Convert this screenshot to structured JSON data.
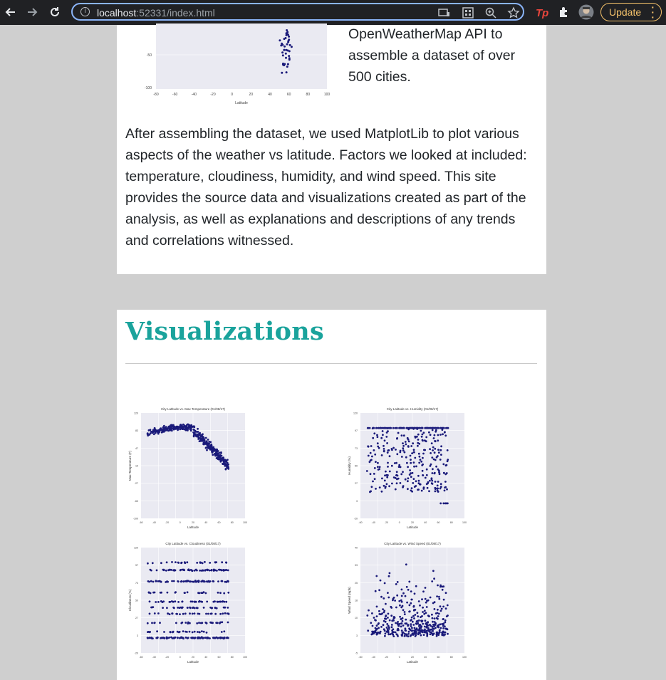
{
  "browser": {
    "url_host": "localhost",
    "url_rest": ":52331/index.html",
    "update_label": "Update"
  },
  "intro": {
    "text": "OpenWeatherMap API to assemble a dataset of over 500 cities."
  },
  "top_plot": {
    "xlabel": "Latitude",
    "x_ticks": [
      "-80",
      "-60",
      "-40",
      "-20",
      "0",
      "20",
      "40",
      "60",
      "80",
      "100"
    ],
    "y_ticks": [
      "-50",
      "-100"
    ]
  },
  "description": "After assembling the dataset, we used MatplotLib to plot various aspects of the weather vs latitude. Factors we looked at included: temperature, cloudiness, humidity, and wind speed. This site provides the source data and visualizations created as part of the analysis, as well as explanations and descriptions of any trends and correlations witnessed.",
  "visualizations": {
    "title": "Visualizations"
  },
  "chart_data": [
    {
      "type": "scatter",
      "title": "City Latitude vs. Max Temperature (01/08/17)",
      "xlabel": "Latitude",
      "ylabel": "Max Temperature (F)",
      "xlim": [
        -60,
        100
      ],
      "ylim": [
        -100,
        120
      ],
      "pattern": "temperature"
    },
    {
      "type": "scatter",
      "title": "City Latitude vs. Humidity (01/08/17)",
      "xlabel": "Latitude",
      "ylabel": "Humidity (%)",
      "xlim": [
        -60,
        100
      ],
      "ylim": [
        -20,
        120
      ],
      "pattern": "humidity"
    },
    {
      "type": "scatter",
      "title": "City Latitude vs. Cloudiness (01/08/17)",
      "xlabel": "Latitude",
      "ylabel": "Cloudiness (%)",
      "xlim": [
        -60,
        100
      ],
      "ylim": [
        -20,
        120
      ],
      "pattern": "cloudiness"
    },
    {
      "type": "scatter",
      "title": "City Latitude vs. Wind Speed (01/08/17)",
      "xlabel": "Latitude",
      "ylabel": "Wind Speed (mph)",
      "xlim": [
        -60,
        100
      ],
      "ylim": [
        -5,
        40
      ],
      "pattern": "wind"
    }
  ],
  "colors": {
    "accent": "#1aa39c",
    "plot_bg": "#eaeaf2",
    "marker": "#1a1a7a"
  }
}
